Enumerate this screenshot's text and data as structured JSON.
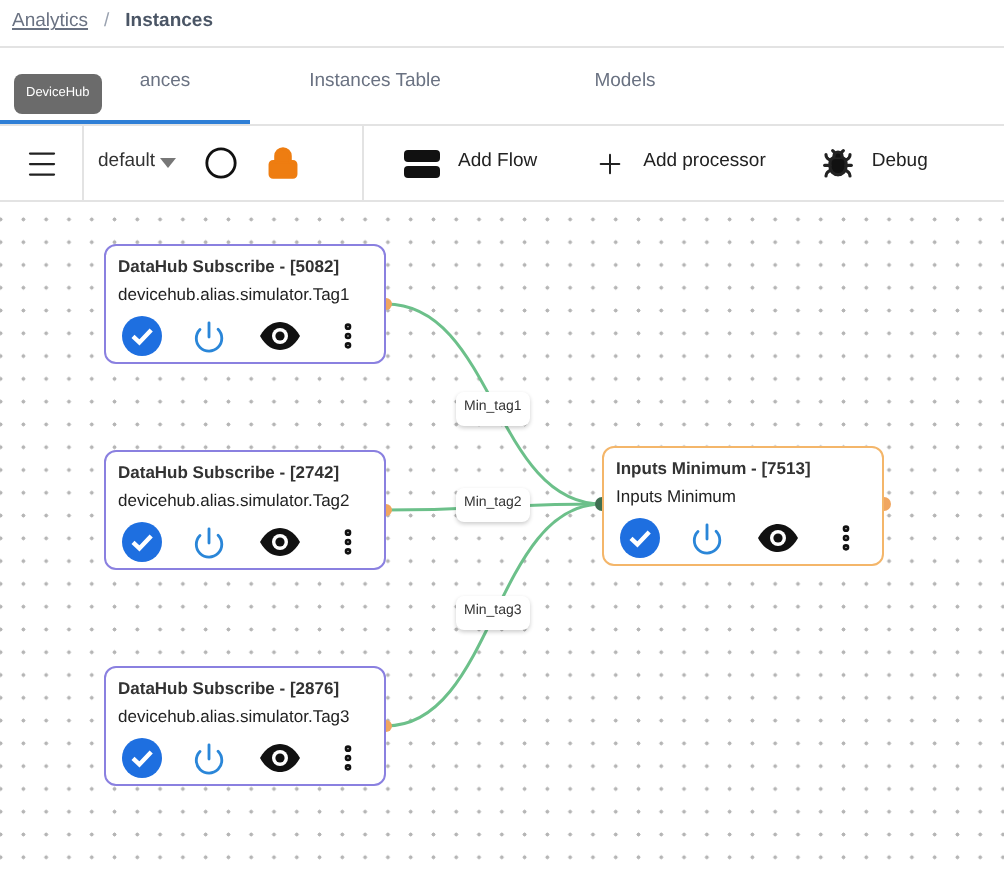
{
  "breadcrumb_separator": "/",
  "breadcrumb": [
    {
      "label": "Analytics",
      "kind": "link"
    },
    {
      "label": "Instances",
      "kind": "current"
    }
  ],
  "tabs": [
    {
      "label": "ances",
      "selected": true
    },
    {
      "label": "Instances Table",
      "selected": false
    },
    {
      "label": "Models",
      "selected": false
    }
  ],
  "tooltip": "DeviceHub",
  "toolbar": {
    "flow_select": "default",
    "actions": [
      {
        "label": "Add Flow",
        "kind": "flow"
      },
      {
        "label": "Add processor",
        "kind": "plus"
      },
      {
        "label": "Debug",
        "kind": "bug"
      }
    ]
  },
  "nodes": [
    {
      "kind": "source",
      "title": "DataHub Subscribe - [5082]",
      "subtitle": "devicehub.alias.simulator.Tag1",
      "edge_label": "Min_tag1"
    },
    {
      "kind": "source",
      "title": "DataHub Subscribe - [2742]",
      "subtitle": "devicehub.alias.simulator.Tag2",
      "edge_label": "Min_tag2"
    },
    {
      "kind": "source",
      "title": "DataHub Subscribe - [2876]",
      "subtitle": "devicehub.alias.simulator.Tag3",
      "edge_label": "Min_tag3"
    },
    {
      "kind": "processor",
      "title": "Inputs Minimum - [7513]",
      "subtitle": "Inputs Minimum"
    }
  ]
}
